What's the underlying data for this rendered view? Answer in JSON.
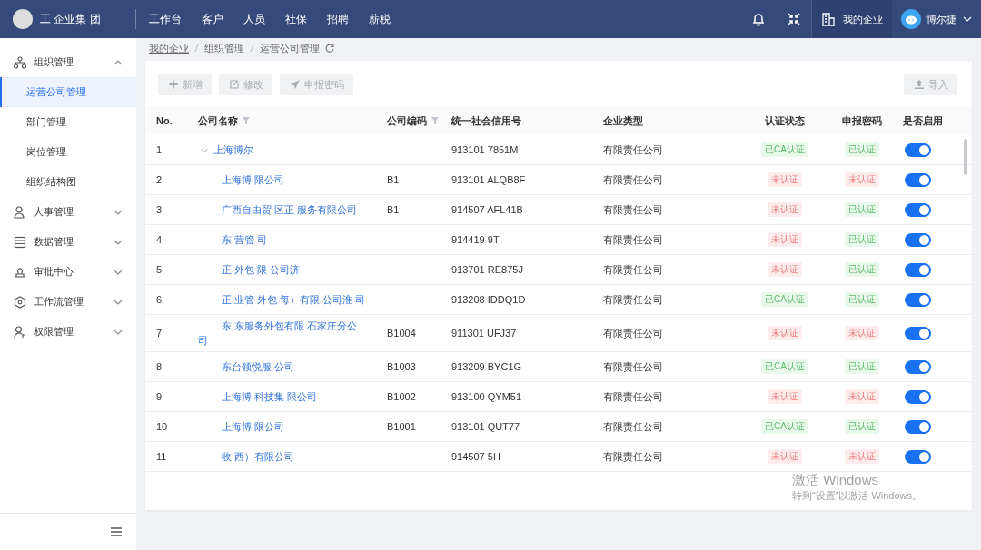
{
  "header": {
    "org_name": "工 企业集 团",
    "nav": [
      "工作台",
      "客户",
      "人员",
      "社保",
      "招聘",
      "薪税"
    ],
    "enterprise_button": "我的企业",
    "user": "博尔捷"
  },
  "sidebar": {
    "items": [
      {
        "label": "组织管理",
        "expanded": true,
        "children": [
          {
            "label": "运营公司管理",
            "selected": true
          },
          {
            "label": "部门管理",
            "selected": false
          },
          {
            "label": "岗位管理",
            "selected": false
          },
          {
            "label": "组织结构图",
            "selected": false
          }
        ]
      },
      {
        "label": "人事管理",
        "expanded": false
      },
      {
        "label": "数据管理",
        "expanded": false
      },
      {
        "label": "审批中心",
        "expanded": false
      },
      {
        "label": "工作流管理",
        "expanded": false
      },
      {
        "label": "权限管理",
        "expanded": false
      }
    ]
  },
  "breadcrumb": [
    "我的企业",
    "组织管理",
    "运营公司管理"
  ],
  "toolbar": {
    "buttons": [
      {
        "label": "新增",
        "disabled": true
      },
      {
        "label": "修改",
        "disabled": true
      },
      {
        "label": "申报密码",
        "disabled": true
      }
    ],
    "import_button": {
      "label": "导入",
      "disabled": true
    }
  },
  "table": {
    "columns": [
      {
        "label": "No."
      },
      {
        "label": "公司名称",
        "filter": true
      },
      {
        "label": "公司编码",
        "filter": true
      },
      {
        "label": "统一社会信用号"
      },
      {
        "label": "企业类型"
      },
      {
        "label": "认证状态"
      },
      {
        "label": "申报密码"
      },
      {
        "label": "是否启用"
      }
    ],
    "rows": [
      {
        "no": "1",
        "name": "上海博尔",
        "credit": "913101 7851M",
        "type": "有限责任公司",
        "auth": {
          "text": "已CA认证",
          "verified": true
        },
        "password": {
          "text": "已认证",
          "verified": true
        },
        "enabled": true,
        "expanded": true,
        "children": [
          {
            "no": "2",
            "name": "上海博 限公司",
            "code": "B1",
            "credit": "913101 ALQB8F",
            "type": "有限责任公司",
            "auth": {
              "text": "未认证",
              "verified": false
            },
            "password": {
              "text": "未认证",
              "verified": false
            },
            "enabled": true
          },
          {
            "no": "3",
            "name": "广西自由贸 区正 服务有限公司",
            "code": "B1",
            "credit": "914507 AFL41B",
            "type": "有限责任公司",
            "auth": {
              "text": "未认证",
              "verified": false
            },
            "password": {
              "text": "已认证",
              "verified": true
            },
            "enabled": true
          },
          {
            "no": "4",
            "name": "东 营管 司",
            "credit": "914419 9T",
            "type": "有限责任公司",
            "auth": {
              "text": "未认证",
              "verified": false
            },
            "password": {
              "text": "已认证",
              "verified": true
            },
            "enabled": true
          },
          {
            "no": "5",
            "name": "正 外包 限 公司济",
            "credit": "913701 RE875J",
            "type": "有限责任公司",
            "auth": {
              "text": "未认证",
              "verified": false
            },
            "password": {
              "text": "已认证",
              "verified": true
            },
            "enabled": true
          },
          {
            "no": "6",
            "name": "正 业管 外包 每）有限 公司淮 司",
            "credit": "913208 IDDQ1D",
            "type": "有限责任公司",
            "auth": {
              "text": "已CA认证",
              "verified": true
            },
            "password": {
              "text": "已认证",
              "verified": true
            },
            "enabled": true
          },
          {
            "no": "7",
            "name": "东 东服务外包有限 石家庄分公司",
            "code": "B1004",
            "credit": "911301 UFJ37",
            "type": "有限责任公司",
            "auth": {
              "text": "未认证",
              "verified": false
            },
            "password": {
              "text": "未认证",
              "verified": false
            },
            "enabled": true
          },
          {
            "no": "8",
            "name": "东台领悦服 公司",
            "code": "B1003",
            "credit": "913209 BYC1G",
            "type": "有限责任公司",
            "auth": {
              "text": "已CA认证",
              "verified": true
            },
            "password": {
              "text": "已认证",
              "verified": true
            },
            "enabled": true
          },
          {
            "no": "9",
            "name": "上海博 科技集 限公司",
            "code": "B1002",
            "credit": "913100 QYM51",
            "type": "有限责任公司",
            "auth": {
              "text": "未认证",
              "verified": false
            },
            "password": {
              "text": "未认证",
              "verified": false
            },
            "enabled": true
          },
          {
            "no": "10",
            "name": "上海博 限公司",
            "code": "B1001",
            "credit": "913101 QUT77",
            "type": "有限责任公司",
            "auth": {
              "text": "已CA认证",
              "verified": true
            },
            "password": {
              "text": "已认证",
              "verified": true
            },
            "enabled": true
          },
          {
            "no": "11",
            "name": "收 西）有限公司",
            "credit": "914507 5H",
            "type": "有限责任公司",
            "auth": {
              "text": "未认证",
              "verified": false
            },
            "password": {
              "text": "未认证",
              "verified": false
            },
            "enabled": true
          }
        ]
      }
    ]
  },
  "os_notice": {
    "title": "激活 Windows",
    "text": "转到“设置”以激活 Windows。"
  }
}
